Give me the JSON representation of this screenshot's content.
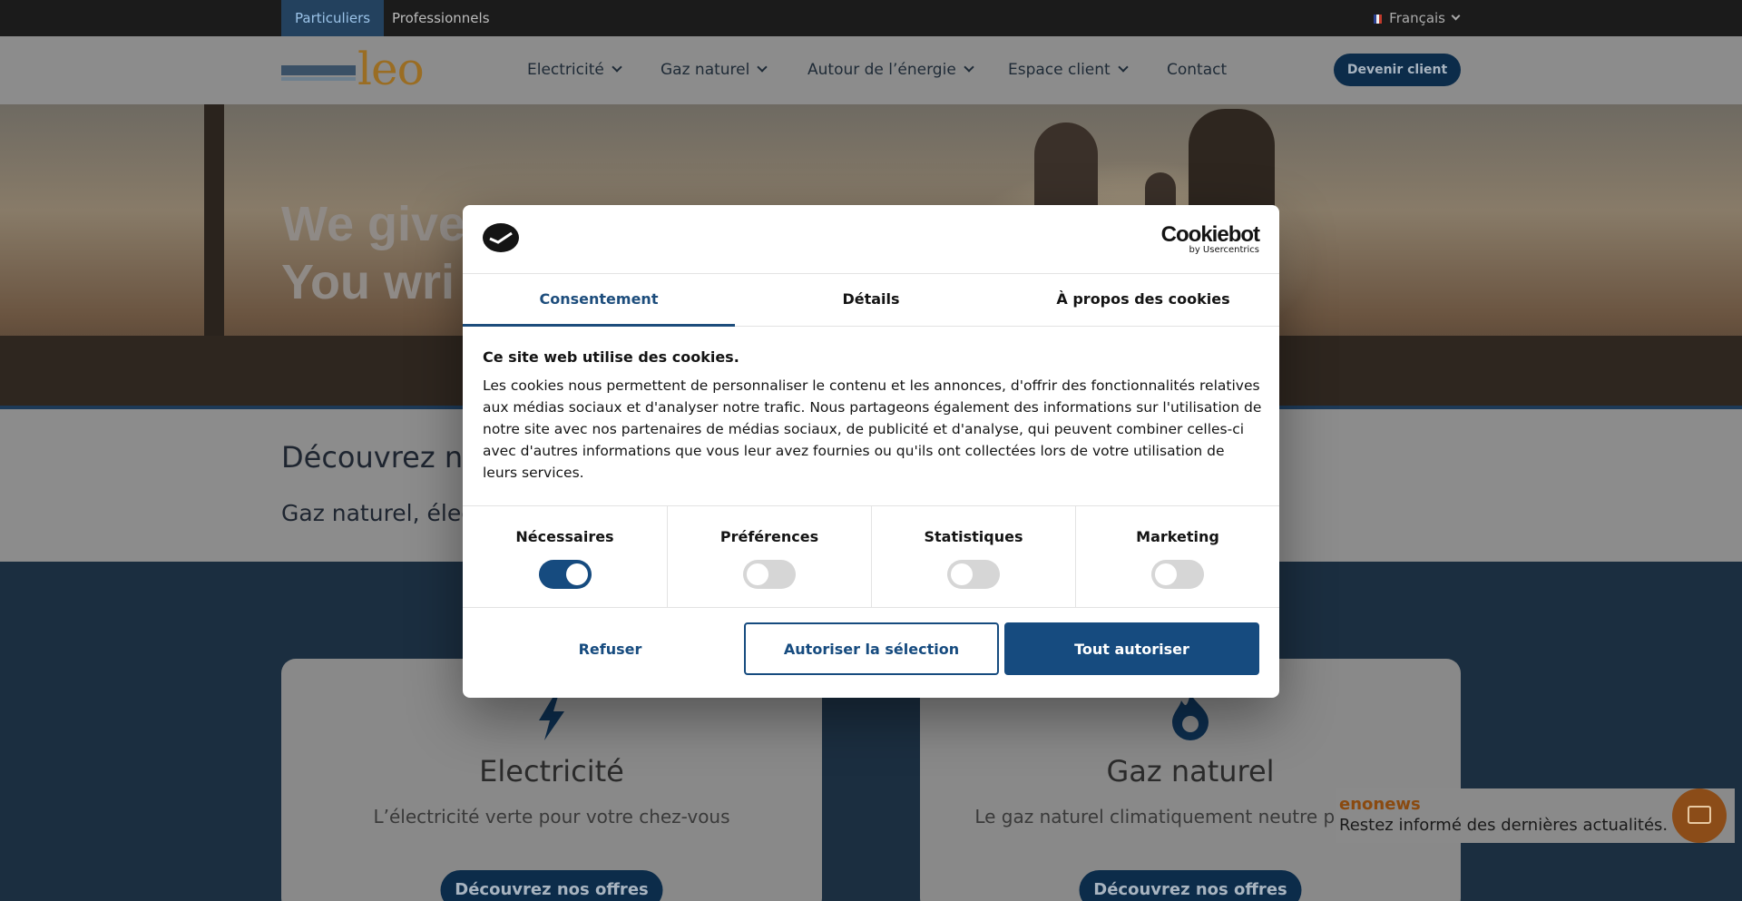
{
  "topbar": {
    "segments": [
      "Particuliers",
      "Professionnels"
    ],
    "language": "Français"
  },
  "header": {
    "logo_text": "leo",
    "nav": [
      "Electricité",
      "Gaz naturel",
      "Autour de l’énergie",
      "Espace client",
      "Contact"
    ],
    "cta": "Devenir client"
  },
  "hero": {
    "headline": "We give\nYou wri"
  },
  "discover": {
    "title": "Découvrez n",
    "subtitle": "Gaz naturel, élec"
  },
  "cards": [
    {
      "icon": "bolt-icon",
      "title": "Electricité",
      "desc": "L’électricité verte pour votre chez-vous",
      "button": "Découvrez nos offres"
    },
    {
      "icon": "flame-icon",
      "title": "Gaz naturel",
      "desc": "Le gaz naturel climatiquement neutre pou vous",
      "button": "Découvrez nos offres"
    }
  ],
  "enonews": {
    "title": "enonews",
    "text": "Restez informé des dernières actualités."
  },
  "dialog": {
    "brand": "Cookiebot",
    "brand_sub": "by Usercentrics",
    "tabs": [
      "Consentement",
      "Détails",
      "À propos des cookies"
    ],
    "active_tab": "Consentement",
    "title": "Ce site web utilise des cookies.",
    "text": "Les cookies nous permettent de personnaliser le contenu et les annonces, d'offrir des fonctionnalités relatives aux médias sociaux et d'analyser notre trafic. Nous partageons également des informations sur l'utilisation de notre site avec nos partenaires de médias sociaux, de publicité et d'analyse, qui peuvent combiner celles-ci avec d'autres informations que vous leur avez fournies ou qu'ils ont collectées lors de votre utilisation de leurs services.",
    "toggles": [
      {
        "label": "Nécessaires",
        "on": true
      },
      {
        "label": "Préférences",
        "on": false
      },
      {
        "label": "Statistiques",
        "on": false
      },
      {
        "label": "Marketing",
        "on": false
      }
    ],
    "buttons": {
      "refuse": "Refuser",
      "allow_selection": "Autoriser la sélection",
      "allow_all": "Tout autoriser"
    }
  },
  "colors": {
    "primary": "#164b7f",
    "dark_navy": "#0c2c4a",
    "accent_brown": "#9a6d23"
  }
}
